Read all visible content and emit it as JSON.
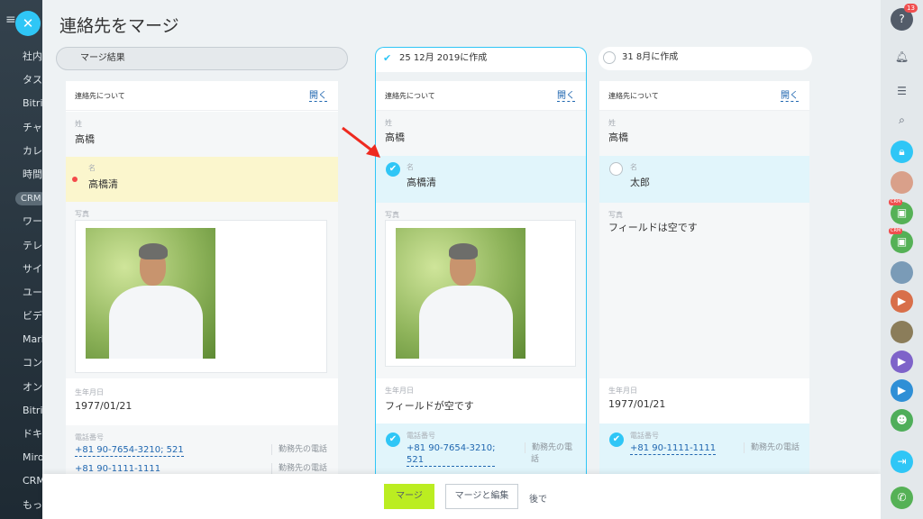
{
  "left_sidebar": {
    "items": [
      "社内",
      "タス",
      "Bitri",
      "チャ",
      "カレ",
      "時間",
      "CRM",
      "ワー",
      "テレ",
      "サイ",
      "ユー",
      "ビデ",
      "Mark",
      "コン",
      "オン",
      "Bitrix",
      "ドキ",
      "Miro",
      "CRM",
      "もっ"
    ]
  },
  "title": "連絡先をマージ",
  "columns": {
    "merge": {
      "header": "マージ結果"
    },
    "a": {
      "header": "25 12月 2019に作成"
    },
    "b": {
      "header": "31 8月に作成"
    }
  },
  "section": {
    "label": "連絡先について",
    "open": "開く"
  },
  "labels": {
    "last_name": "姓",
    "first_name": "名",
    "photo": "写真",
    "birthday": "生年月日",
    "phone": "電話番号"
  },
  "merge": {
    "last_name": "高橋",
    "first_name": "高橋清",
    "birthday": "1977/01/21",
    "phones": [
      {
        "number": "+81 90-7654-3210; 521",
        "type": "勤務先の電話"
      },
      {
        "number": "+81 90-1111-1111",
        "type": "勤務先の電話"
      }
    ]
  },
  "a": {
    "last_name": "高橋",
    "first_name": "高橋清",
    "birthday": "フィールドが空です",
    "phone": {
      "number_line1": "+81 90-7654-3210;",
      "number_line2": "521",
      "type_line1": "勤務先の電",
      "type_line2": "話"
    }
  },
  "b": {
    "last_name": "高橋",
    "first_name": "太郎",
    "photo": "フィールドは空です",
    "birthday": "1977/01/21",
    "phone": {
      "number": "+81 90-1111-1111",
      "type": "勤務先の電話"
    }
  },
  "footer": {
    "merge": "マージ",
    "merge_edit": "マージと編集",
    "later": "後で"
  },
  "right_bar": {
    "badge": "13"
  },
  "colors": {
    "accent": "#2fc6f6",
    "merge_button": "#bbed21",
    "highlight_yellow": "#fbf6cd",
    "highlight_blue": "#e1f5fb",
    "link": "#2067b0"
  }
}
